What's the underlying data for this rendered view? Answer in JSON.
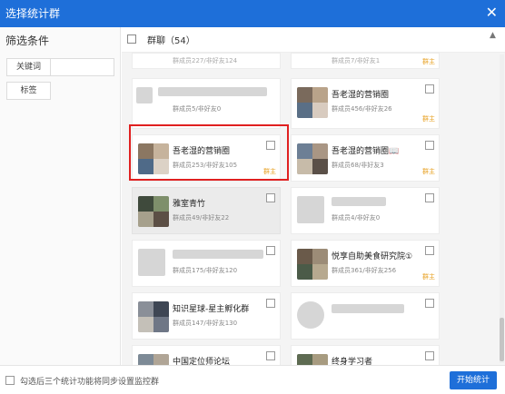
{
  "window": {
    "title": "选择统计群",
    "close_glyph": "✕"
  },
  "sidebar": {
    "heading": "筛选条件",
    "keyword_label": "关键词",
    "tag_label": "标签"
  },
  "main": {
    "header_label": "群聊（54）"
  },
  "cards": [
    {
      "name": "吾老湿的营销圈",
      "stats": "群成员456/非好友26",
      "badge": "群主"
    },
    {
      "name": "吾老湿的营销圈",
      "stats": "群成员253/非好友105",
      "badge": "群主"
    },
    {
      "name": "吾老湿的营销圈📖",
      "stats": "群成员68/非好友3",
      "badge": "群主"
    },
    {
      "name": "雅室青竹",
      "stats": "群成员49/非好友22",
      "badge": ""
    },
    {
      "name": "",
      "stats": "群成员4/非好友0",
      "badge": ""
    },
    {
      "name": "",
      "stats": "群成员175/非好友120",
      "badge": ""
    },
    {
      "name": "悦享自助美食研究院①",
      "stats": "群成员361/非好友256",
      "badge": "群主"
    },
    {
      "name": "知识星球-星主孵化群",
      "stats": "群成员147/非好友130",
      "badge": ""
    },
    {
      "name": "",
      "stats": "",
      "badge": ""
    },
    {
      "name": "中国定位师论坛",
      "stats": "",
      "badge": ""
    },
    {
      "name": "终身学习者",
      "stats": "",
      "badge": ""
    }
  ],
  "partials": {
    "top_left": "群成员227/非好友124",
    "top_right": "群成员7/非好友1",
    "top_right_badge": "群主",
    "left_row2": "群成员5/非好友0"
  },
  "footer": {
    "sync_label": "勾选后三个统计功能将同步设置监控群",
    "start_label": "开始统计"
  },
  "colors": {
    "accent": "#1e6fd9",
    "badge": "#e7a021",
    "highlight": "#e02020"
  }
}
